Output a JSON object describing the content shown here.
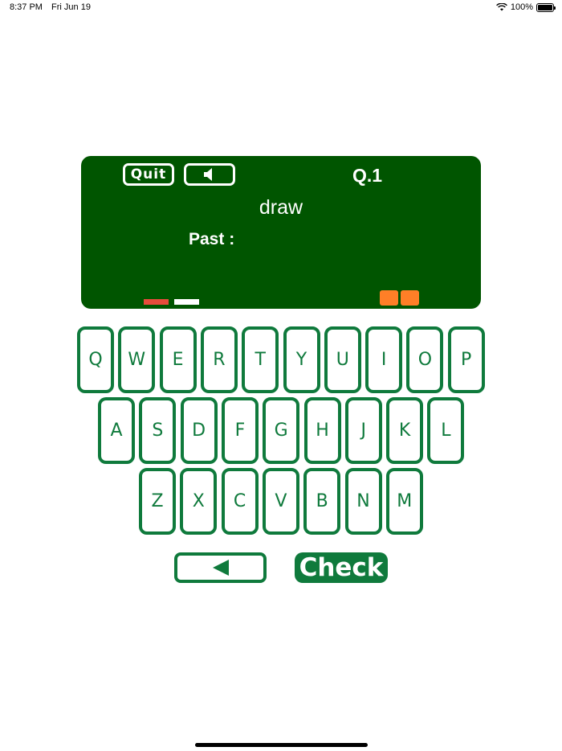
{
  "status": {
    "time": "8:37 PM",
    "date": "Fri Jun 19",
    "battery": "100%",
    "battery_level": 1.0
  },
  "board": {
    "quit_label": "Quit",
    "sound_icon": "speaker-icon",
    "question_number": "Q.1",
    "word": "draw",
    "prompt_label": "Past :",
    "answer": "",
    "progress_colors": [
      "#e74c3c",
      "#ffffff"
    ],
    "eraser_icon": "eraser-icon"
  },
  "keyboard": {
    "row1": [
      "Q",
      "W",
      "E",
      "R",
      "T",
      "Y",
      "U",
      "I",
      "O",
      "P"
    ],
    "row2": [
      "A",
      "S",
      "D",
      "F",
      "G",
      "H",
      "J",
      "K",
      "L"
    ],
    "row3": [
      "Z",
      "X",
      "C",
      "V",
      "B",
      "N",
      "M"
    ]
  },
  "controls": {
    "backspace_icon": "left-triangle-icon",
    "check_label": "Check"
  },
  "colors": {
    "board": "#005500",
    "accent": "#0f7a3c",
    "eraser": "#ff7f27"
  }
}
